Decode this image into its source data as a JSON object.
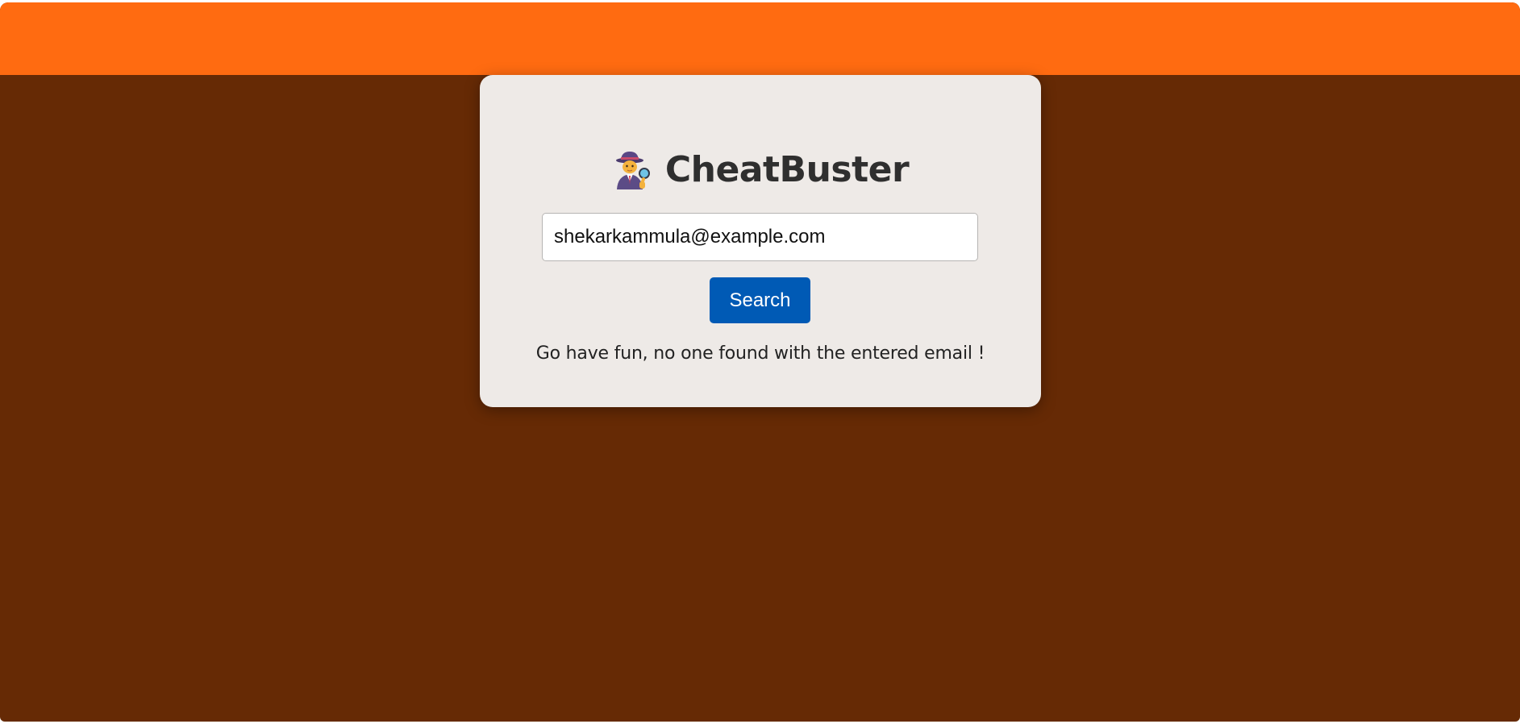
{
  "header": {
    "color": "#ff6b11"
  },
  "background": {
    "color": "#662a05"
  },
  "card": {
    "title": "CheatBuster",
    "title_icon": "detective-icon",
    "search": {
      "value": "shekarkammula@example.com",
      "placeholder": ""
    },
    "search_button_label": "Search",
    "search_button_color": "#005ab5",
    "result_message": "Go have fun, no one found with the entered email !"
  }
}
